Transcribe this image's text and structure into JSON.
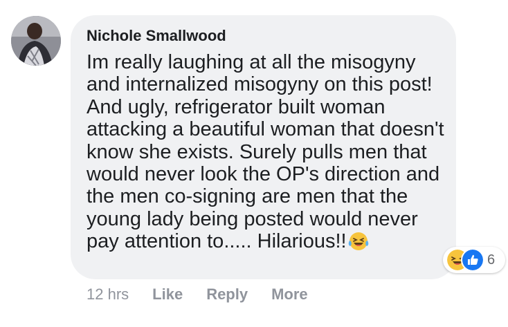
{
  "comment": {
    "author": "Nichole Smallwood",
    "text": "Im really laughing at all the misogyny and internalized misogyny on this post! And ugly, refrigerator built woman attacking a beautiful woman that doesn't know she exists. Surely pulls men that would never look the OP's direction and the men co-signing are men that the young lady being posted would never pay attention to..... Hilarious!!",
    "text_emoji": "laughing-with-tears-emoji",
    "reactions": {
      "icons": [
        "haha-reaction-icon",
        "like-reaction-icon"
      ],
      "count": "6"
    },
    "actions": {
      "timestamp": "12 hrs",
      "like": "Like",
      "reply": "Reply",
      "more": "More"
    }
  },
  "colors": {
    "bubble": "#f0f1f3",
    "text": "#1c1e21",
    "muted": "#90949c",
    "like_blue": "#1877f2",
    "haha_yellow": "#f7c43d"
  }
}
